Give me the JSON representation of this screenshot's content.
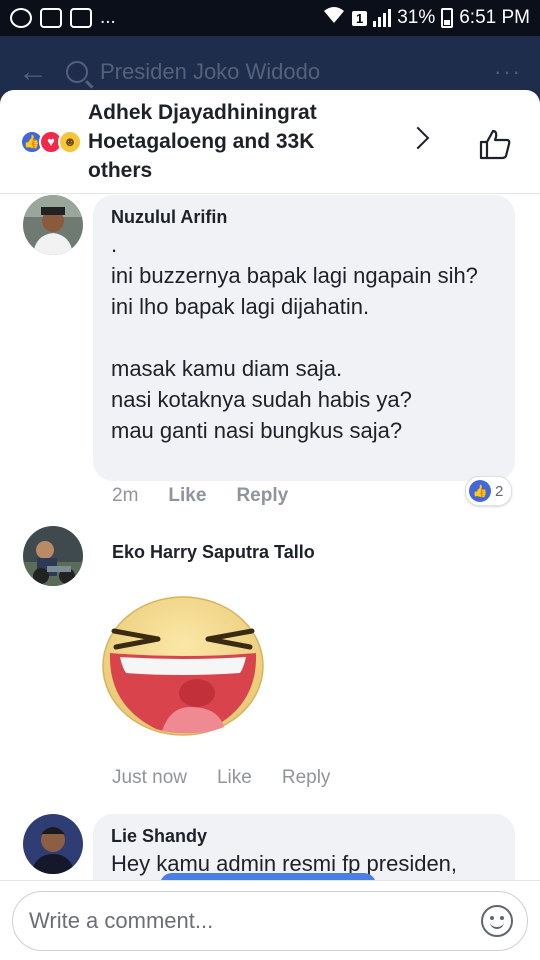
{
  "status_bar": {
    "left_icons": [
      "whatsapp-icon",
      "gallery-icon",
      "checkbox-icon"
    ],
    "overflow": "...",
    "sim_badge": "1",
    "battery_percent": "31%",
    "time": "6:51 PM"
  },
  "header": {
    "search_text": "Presiden Joko Widodo",
    "more": "···"
  },
  "reactions": {
    "reactors_text": "Adhek Djayadhiningrat Hoetagaloeng and 33K others",
    "icons": [
      "like-icon",
      "love-icon",
      "haha-icon"
    ]
  },
  "comments": [
    {
      "name": "Nuzulul Arifin",
      "text": ".\nini buzzernya bapak lagi ngapain sih?\nini lho bapak lagi dijahatin.\n\nmasak kamu diam saja.\nnasi kotaknya sudah habis ya?\nmau ganti nasi bungkus saja?",
      "time": "2m",
      "like": "Like",
      "reply": "Reply",
      "reaction_count": "2"
    },
    {
      "name": "Eko Harry Saputra Tallo",
      "sticker": "laughing-face-sticker",
      "time": "Just now",
      "like": "Like",
      "reply": "Reply"
    },
    {
      "name": "Lie Shandy",
      "text": "Hey kamu admin resmi fp presiden,"
    }
  ],
  "composer": {
    "placeholder": "Write a comment..."
  },
  "colors": {
    "brand_blue": "#4267d8",
    "header_bg": "#1f2d4c",
    "bubble_bg": "#f1f2f5"
  }
}
